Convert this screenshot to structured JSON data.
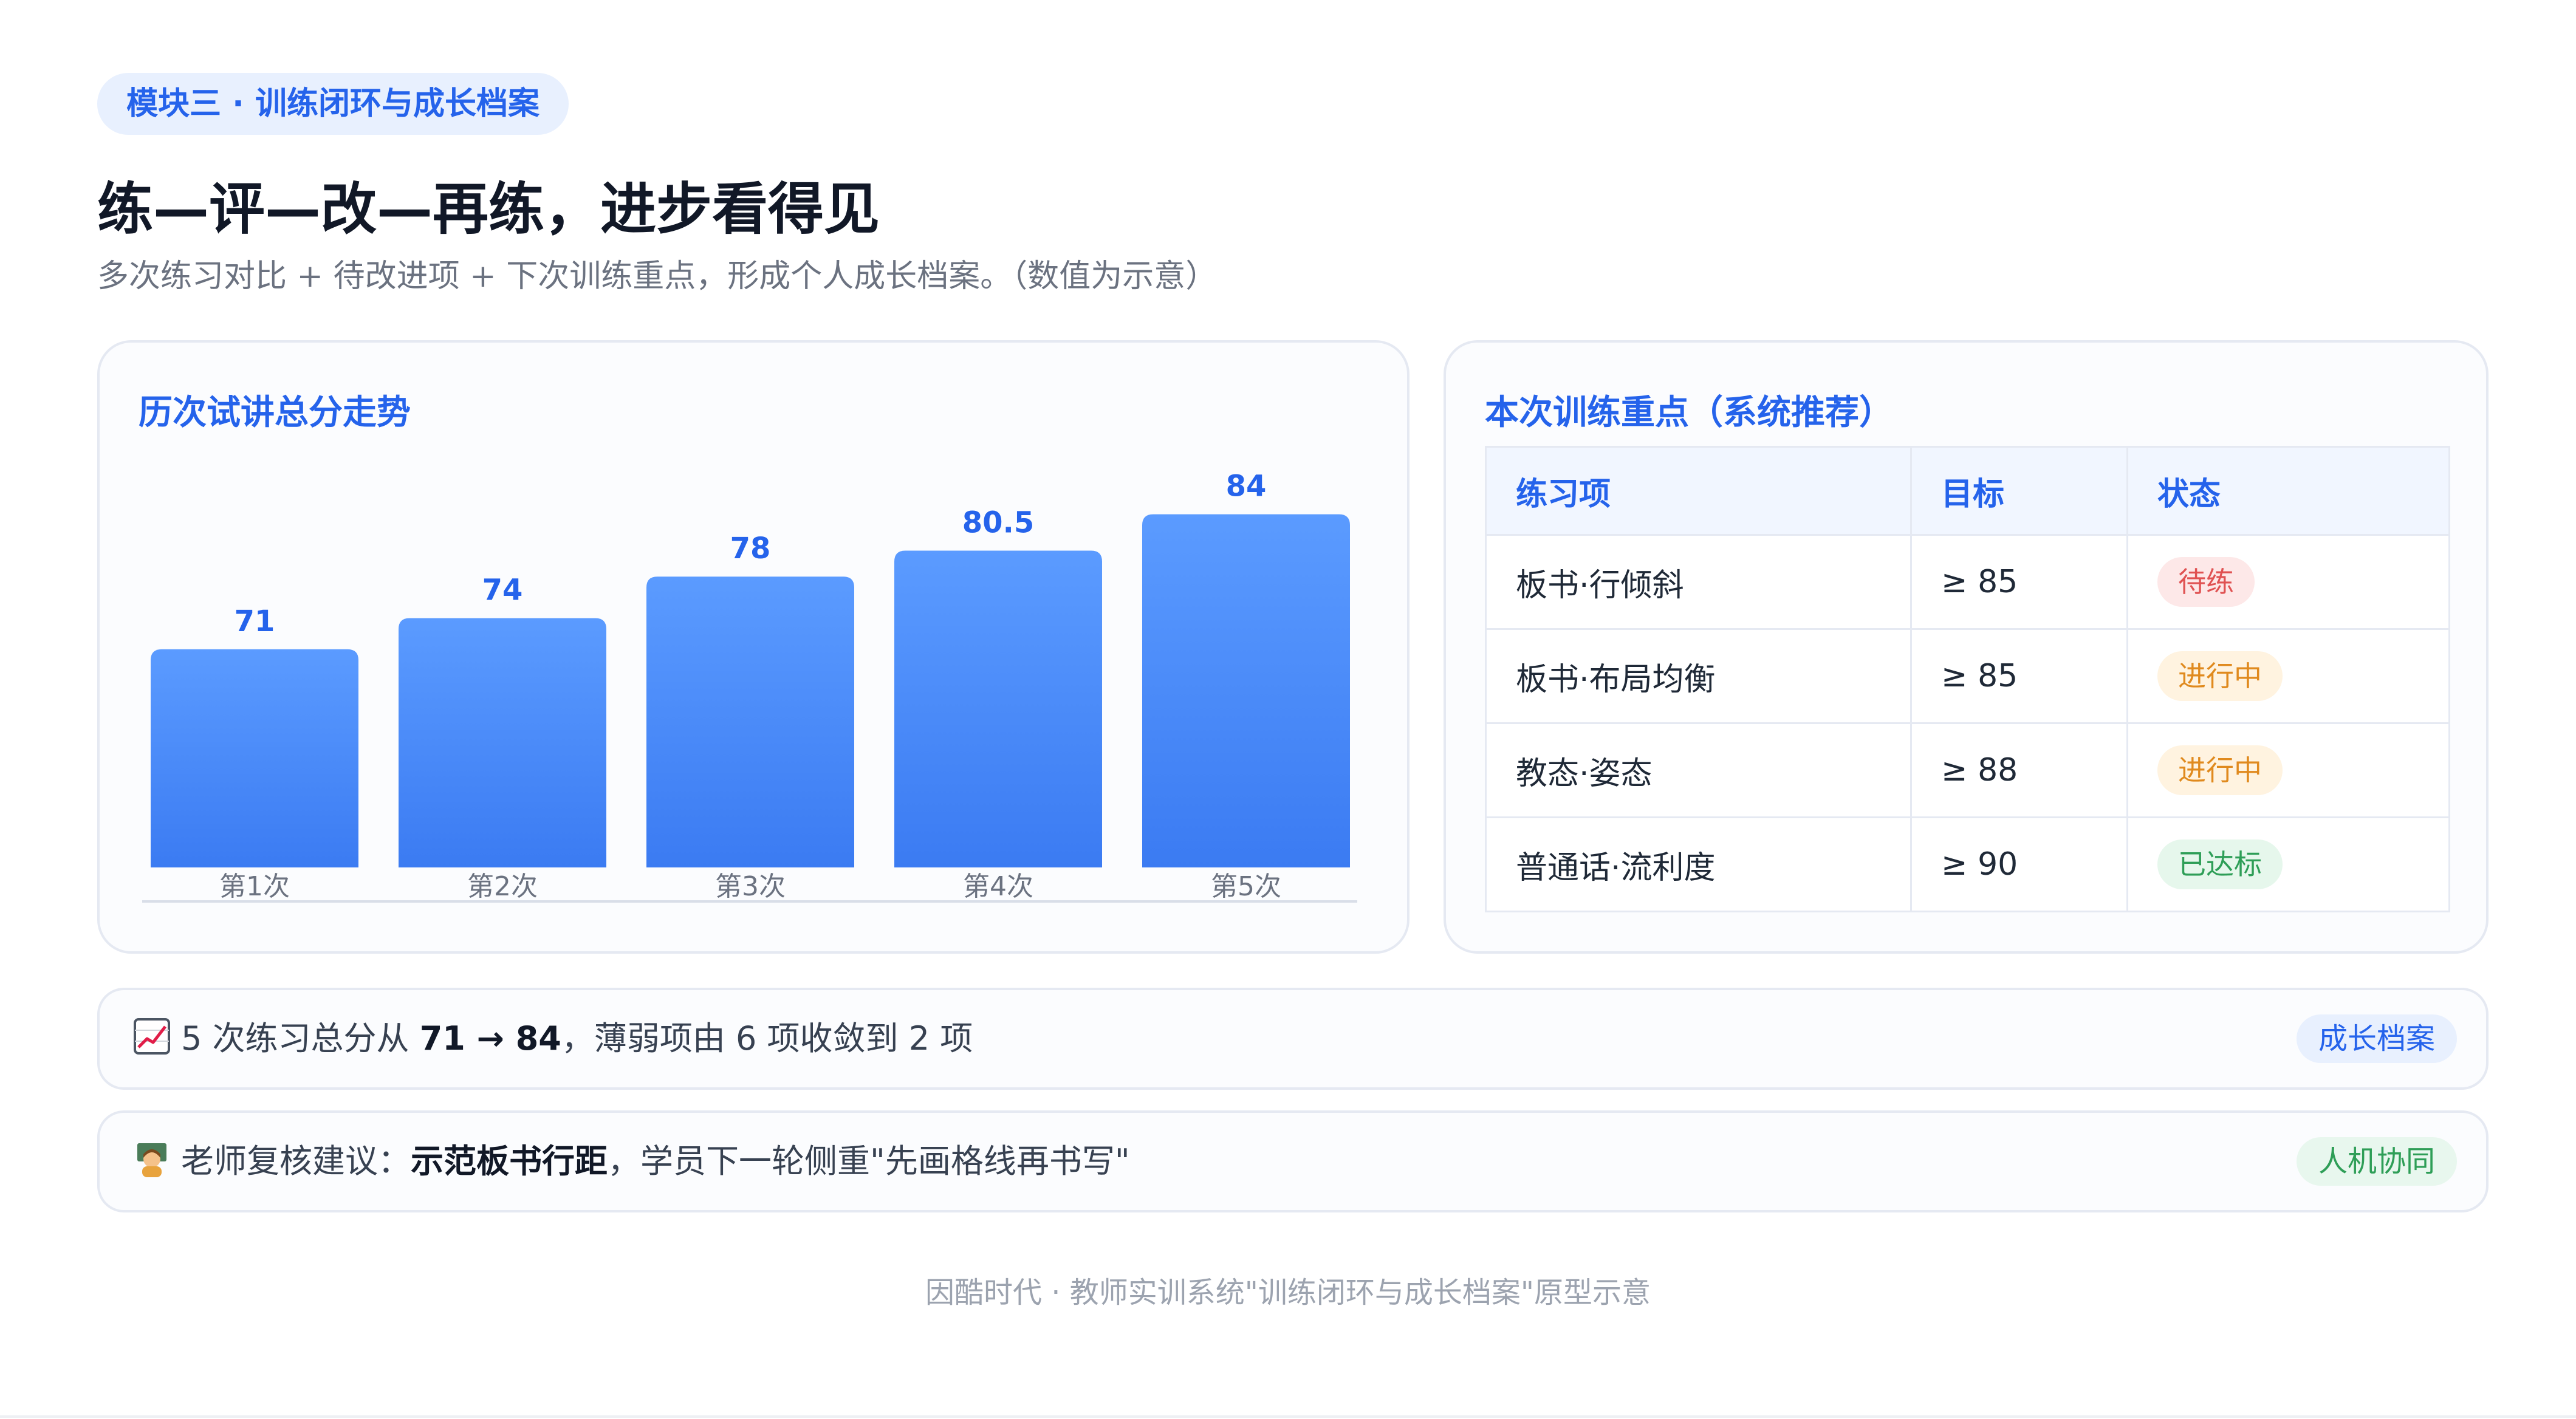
{
  "module_label": "模块三 · 训练闭环与成长档案",
  "title": "练—评—改—再练，进步看得见",
  "subtitle": "多次练习对比 + 待改进项 + 下次训练重点，形成个人成长档案。（数值为示意）",
  "chart_card": {
    "title": "历次试讲总分走势"
  },
  "chart_data": {
    "type": "bar",
    "title": "历次试讲总分走势",
    "categories": [
      "第1次",
      "第2次",
      "第3次",
      "第4次",
      "第5次"
    ],
    "values": [
      71,
      74,
      78,
      80.5,
      84
    ],
    "value_labels": [
      "71",
      "74",
      "78",
      "80.5",
      "84"
    ],
    "ylim": [
      50,
      90
    ],
    "grid": false,
    "bar_color": "#3b7bf2",
    "bar_color_top": "#5b9bff",
    "label_color": "#2563eb"
  },
  "focus_card": {
    "title": "本次训练重点（系统推荐）",
    "headers": [
      "练习项",
      "目标",
      "状态"
    ],
    "rows": [
      {
        "item": "板书·行倾斜",
        "target": "≥ 85",
        "status": "待练"
      },
      {
        "item": "板书·布局均衡",
        "target": "≥ 85",
        "status": "进行中"
      },
      {
        "item": "教态·姿态",
        "target": "≥ 88",
        "status": "进行中"
      },
      {
        "item": "普通话·流利度",
        "target": "≥ 90",
        "status": "已达标"
      }
    ],
    "status_colors": {
      "待练": {
        "bg": "#fde8e8",
        "fg": "#e05252"
      },
      "进行中": {
        "bg": "#fff3e0",
        "fg": "#e08a1e"
      },
      "已达标": {
        "bg": "#e6f7ec",
        "fg": "#2e9e57"
      }
    }
  },
  "summary1": {
    "icon": "chart-increasing-icon",
    "prefix": "5 次练习总分从 ",
    "from": "71",
    "arrow": " → ",
    "to": "84",
    "suffix": "，薄弱项由 6 项收敛到 2 项",
    "tag": "成长档案",
    "tag_bg": "#e8f0fe",
    "tag_fg": "#2563eb"
  },
  "summary2": {
    "icon": "teacher-icon",
    "prefix": "老师复核建议：",
    "emph": "示范板书行距",
    "suffix": "，学员下一轮侧重\"先画格线再书写\"",
    "tag": "人机协同",
    "tag_bg": "#e8f7ee",
    "tag_fg": "#2e9e57"
  },
  "footer": "因酷时代 · 教师实训系统\"训练闭环与成长档案\"原型示意"
}
